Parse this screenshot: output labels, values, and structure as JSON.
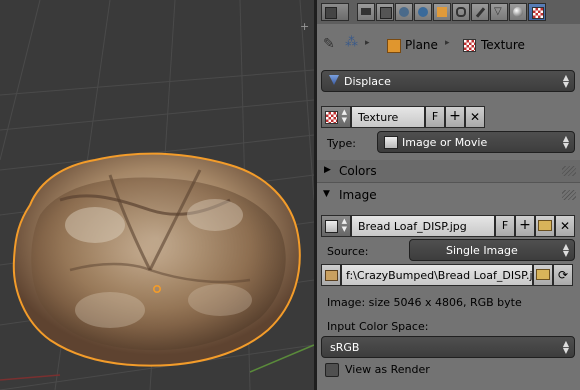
{
  "viewport": {
    "corner_icon": "plus-icon"
  },
  "breadcrumb": {
    "object": "Plane",
    "texture": "Texture"
  },
  "modifier_dropdown": {
    "label": "Displace"
  },
  "texture_datablock": {
    "name": "Texture",
    "fake_user": "F"
  },
  "type_row": {
    "label": "Type:",
    "value": "Image or Movie"
  },
  "sections": {
    "colors": "Colors",
    "image": "Image"
  },
  "image_datablock": {
    "name": "Bread Loaf_DISP.jpg",
    "fake_user": "F"
  },
  "source_row": {
    "label": "Source:",
    "value": "Single Image"
  },
  "filepath": {
    "value": "f:\\CrazyBumped\\Bread Loaf_DISP.jpg"
  },
  "image_info": "Image: size 5046 x 4806, RGB byte",
  "color_space": {
    "label": "Input Color Space:",
    "value": "sRGB"
  },
  "view_as_render": {
    "label": "View as Render",
    "checked": false
  },
  "colors": {
    "accent": "#5680c2",
    "outline": "#f39c2a",
    "panel_bg": "#737373"
  }
}
